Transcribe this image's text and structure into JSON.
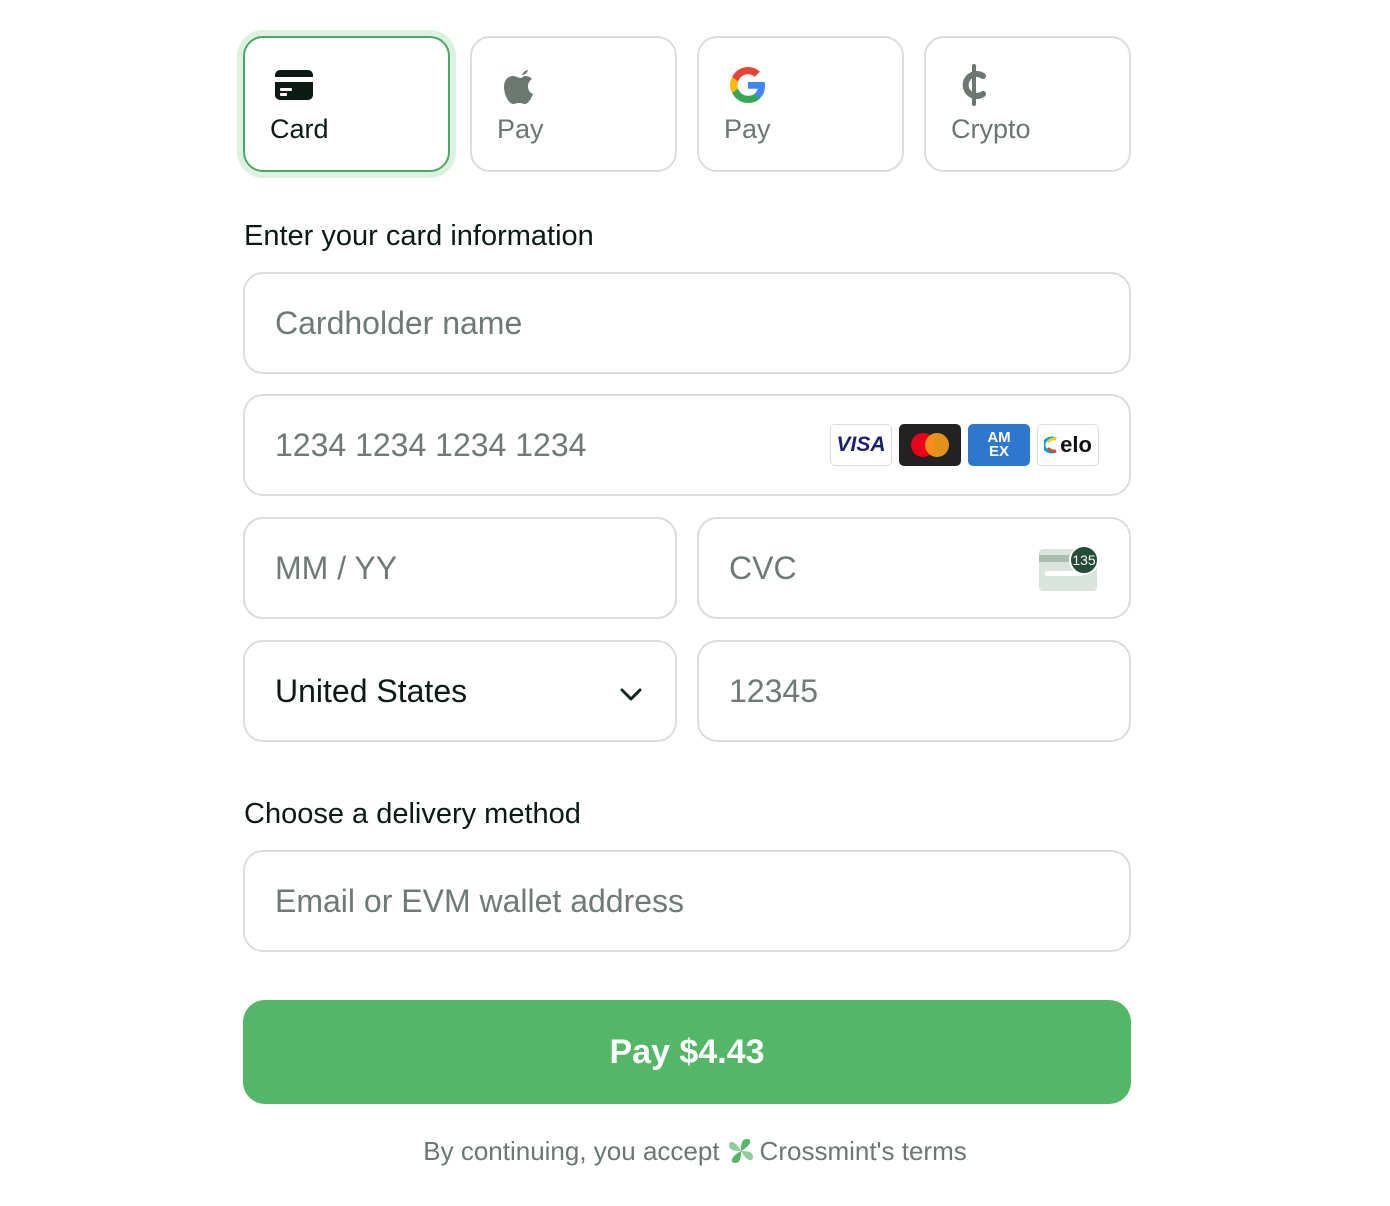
{
  "tabs": [
    {
      "label": "Card",
      "icon": "credit-card-icon",
      "active": true
    },
    {
      "label": "Pay",
      "icon": "apple-icon",
      "active": false
    },
    {
      "label": "Pay",
      "icon": "google-icon",
      "active": false
    },
    {
      "label": "Crypto",
      "icon": "cent-icon",
      "active": false
    }
  ],
  "card_section": {
    "title": "Enter your card information",
    "cardholder_placeholder": "Cardholder name",
    "number_placeholder": "1234 1234 1234 1234",
    "brands": {
      "visa": "VISA",
      "amex": "AM EX",
      "elo": "elo"
    },
    "expiry_placeholder": "MM / YY",
    "cvc_placeholder": "CVC",
    "cvc_badge": "135",
    "country": "United States",
    "zip_placeholder": "12345"
  },
  "delivery_section": {
    "title": "Choose a delivery method",
    "address_placeholder": "Email or EVM wallet address"
  },
  "pay_button": {
    "label": "Pay $4.43"
  },
  "terms": {
    "prefix": "By continuing, you accept",
    "link": "Crossmint's terms"
  },
  "colors": {
    "accent": "#54b767",
    "active_border": "#4aa865",
    "muted_text": "#6b7770",
    "border": "#d9dedb"
  }
}
